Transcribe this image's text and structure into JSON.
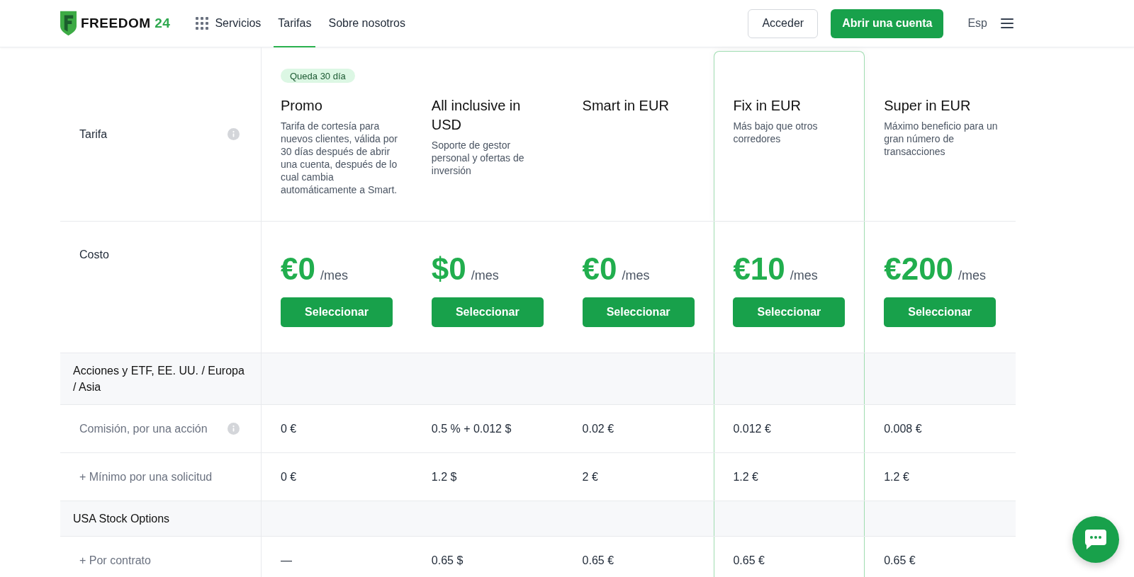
{
  "header": {
    "logo": {
      "wordmark": "FREEDOM",
      "number": "24"
    },
    "nav": [
      {
        "label": "Servicios",
        "kind": "menu",
        "selected": false
      },
      {
        "label": "Tarifas",
        "kind": "link",
        "selected": true
      },
      {
        "label": "Sobre nosotros",
        "kind": "link",
        "selected": false
      }
    ],
    "login_button": "Acceder",
    "signup_button": "Abrir una cuenta",
    "language": "Esp"
  },
  "table": {
    "tariff_label": "Tarifa",
    "tariff_info": true,
    "price_label": "Costo",
    "tariffs": [
      {
        "name": "Promo",
        "badge": "Queda 30 día",
        "description": "Tarifa de cortesía para nuevos clientes, válida por 30 días después de abrir una cuenta, después de lo cual cambia automáticamente a Smart.",
        "price": "€0",
        "period": "/mes",
        "button": "Seleccionar",
        "highlighted": false
      },
      {
        "name": "All inclusive in USD",
        "description": "Soporte de gestor personal y ofertas de inversión",
        "price": "$0",
        "period": "/mes",
        "button": "Seleccionar",
        "highlighted": false
      },
      {
        "name": "Smart in EUR",
        "price": "€0",
        "period": "/mes",
        "button": "Seleccionar",
        "highlighted": false
      },
      {
        "name": "Fix in EUR",
        "description": "Más bajo que otros corredores",
        "price": "€10",
        "period": "/mes",
        "button": "Seleccionar",
        "highlighted": true
      },
      {
        "name": "Super in EUR",
        "description": "Máximo beneficio para un gran número de transacciones",
        "price": "€200",
        "period": "/mes",
        "button": "Seleccionar",
        "highlighted": false
      }
    ],
    "rows": [
      {
        "kind": "section",
        "label": "Acciones y ETF, EE. UU. / Europa / Asia"
      },
      {
        "kind": "value",
        "label": "Comisión, por una acción",
        "info": true,
        "values": [
          "0 €",
          "0.5 % + 0.012 $",
          "0.02 €",
          "0.012 €",
          "0.008 €"
        ]
      },
      {
        "kind": "value",
        "label": "+ Mínimo por una solicitud",
        "info": false,
        "values": [
          "0 €",
          "1.2 $",
          "2 €",
          "1.2 €",
          "1.2 €"
        ]
      },
      {
        "kind": "section",
        "label": "USA Stock Options"
      },
      {
        "kind": "value",
        "label": "+ Por contrato",
        "info": false,
        "values": [
          "—",
          "0.65 $",
          "0.65 €",
          "0.65 €",
          "0.65 €"
        ]
      }
    ]
  }
}
